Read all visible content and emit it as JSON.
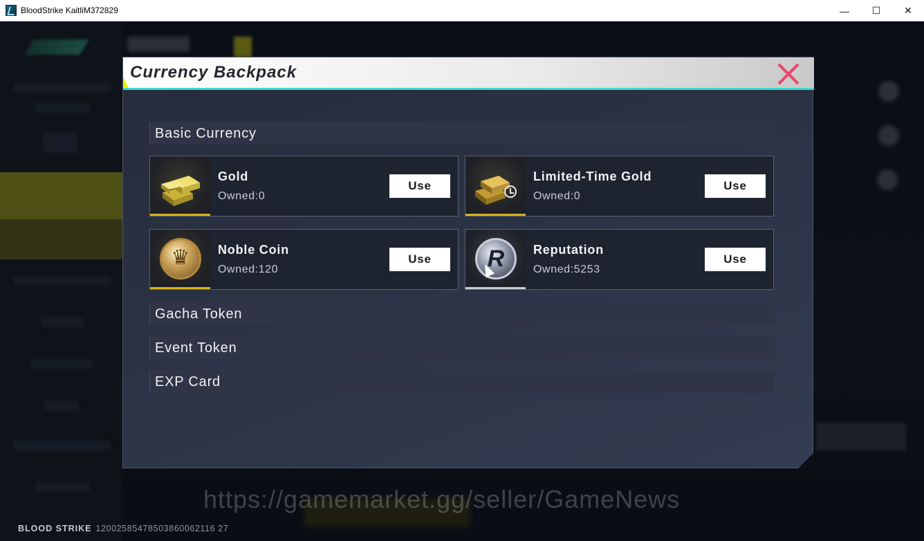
{
  "window": {
    "title": "BloodStrike KaitliM372829",
    "minimize": "—",
    "maximize": "☐",
    "close": "✕"
  },
  "modal": {
    "title": "Currency Backpack",
    "sections": {
      "basic": "Basic Currency",
      "gacha": "Gacha Token",
      "event": "Event Token",
      "exp": "EXP Card"
    },
    "cards": [
      {
        "name": "Gold",
        "owned": "Owned:0",
        "button": "Use",
        "icon": "gold-bars-icon"
      },
      {
        "name": "Limited-Time Gold",
        "owned": "Owned:0",
        "button": "Use",
        "icon": "limited-gold-icon"
      },
      {
        "name": "Noble Coin",
        "owned": "Owned:120",
        "button": "Use",
        "icon": "noble-coin-icon"
      },
      {
        "name": "Reputation",
        "owned": "Owned:5253",
        "button": "Use",
        "icon": "reputation-coin-icon"
      }
    ],
    "close_icon": "close-icon"
  },
  "footer": {
    "brand": "BLOOD STRIKE",
    "id": "12002585478503860062116 27"
  },
  "watermark": "https://gamemarket.gg/seller/GameNews",
  "colors": {
    "accent_cyan": "#3fd8d0",
    "close_pink": "#e8476a",
    "gold_underline": "#d7b21a",
    "header_yellow": "#e6f200"
  }
}
